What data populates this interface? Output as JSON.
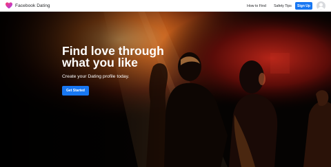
{
  "header": {
    "brand_name": "Facebook Dating",
    "nav": {
      "how_to_find": "How to Find",
      "safety_tips": "Safety Tips",
      "sign_up": "Sign Up"
    }
  },
  "hero": {
    "title_line1": "Find love through",
    "title_line2": "what you like",
    "subtitle": "Create your Dating profile today.",
    "cta_label": "Get Started"
  },
  "colors": {
    "accent": "#1877f2",
    "logo_gradient_start": "#ff3a6b",
    "logo_gradient_end": "#a43df2"
  }
}
